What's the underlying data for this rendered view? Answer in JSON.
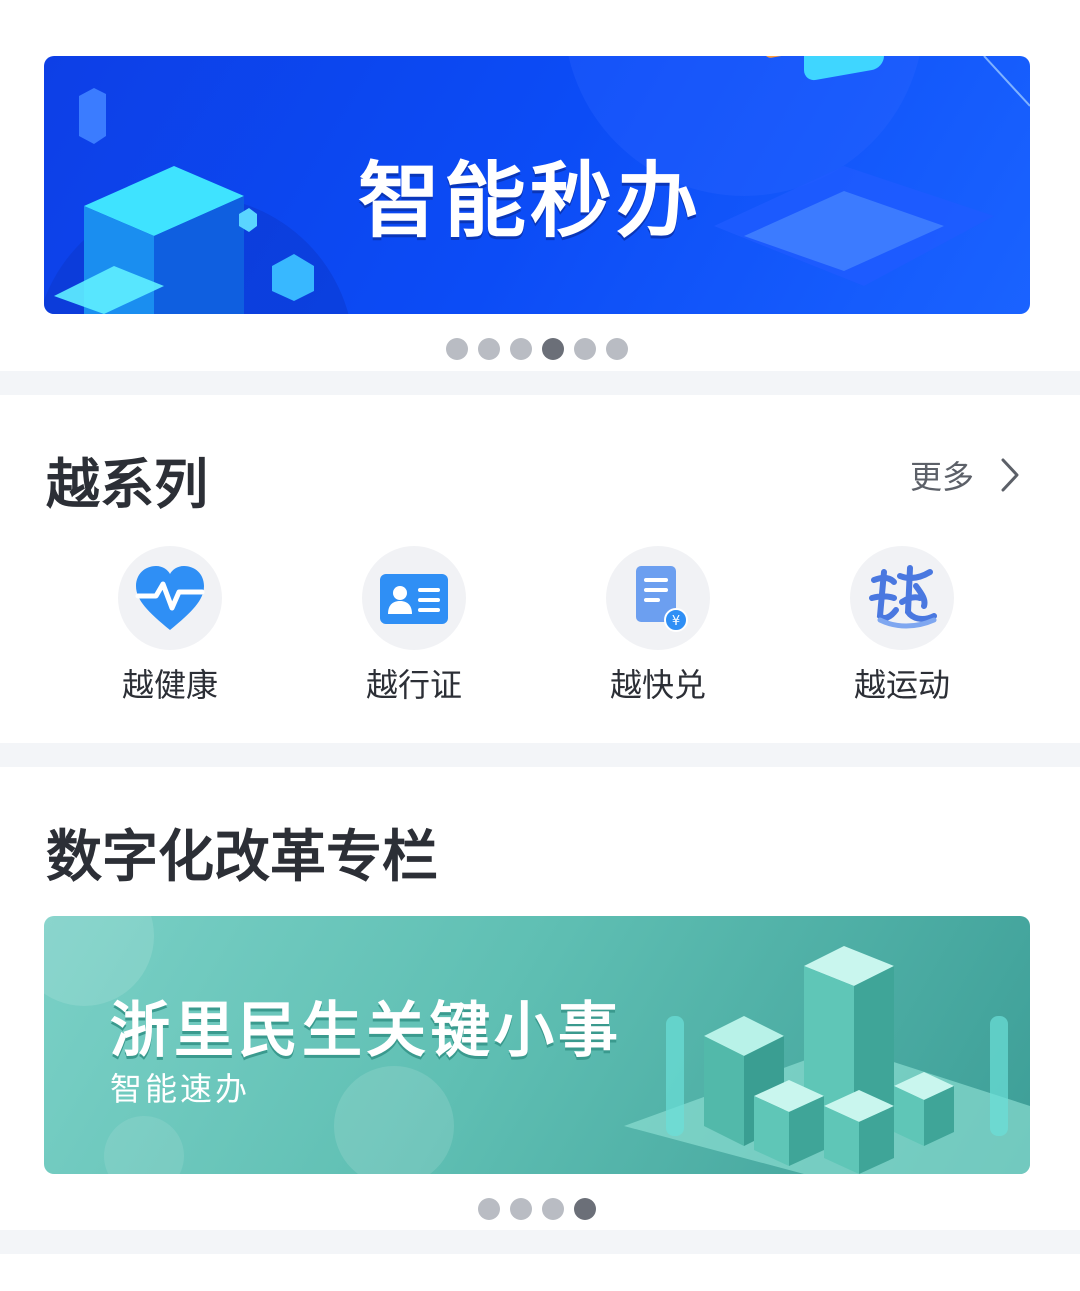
{
  "top_banner": {
    "title": "智能秒办",
    "dot_count": 6,
    "active_index": 3
  },
  "yue_series": {
    "title": "越系列",
    "more_label": "更多",
    "items": [
      {
        "label": "越健康",
        "icon": "heart-pulse-icon"
      },
      {
        "label": "越行证",
        "icon": "id-card-icon"
      },
      {
        "label": "越快兑",
        "icon": "document-yuan-icon"
      },
      {
        "label": "越运动",
        "icon": "yue-calligraphy-icon"
      }
    ]
  },
  "digital_reform": {
    "title": "数字化改革专栏",
    "banner_title": "浙里民生关键小事",
    "banner_subtitle": "智能速办",
    "dot_count": 4,
    "active_index": 3
  },
  "colors": {
    "blue_banner": "#0a49f0",
    "teal_banner": "#5fbfb3",
    "dot_inactive": "#b9bcc3",
    "dot_active": "#6b6f78",
    "section_gap": "#f3f5f8"
  }
}
